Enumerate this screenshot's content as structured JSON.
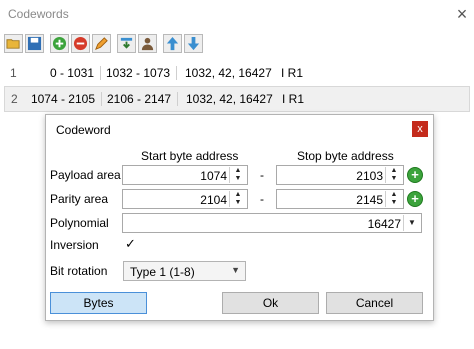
{
  "window": {
    "title": "Codewords",
    "close": "×"
  },
  "toolbar": {
    "icons": [
      "open-folder-icon",
      "save-icon",
      "add-icon",
      "remove-icon",
      "edit-icon",
      "import-icon",
      "user-icon",
      "move-up-icon",
      "move-down-icon"
    ]
  },
  "list": {
    "rows": [
      {
        "index": "1",
        "payload": "0 - 1031",
        "parity": "1032 - 1073",
        "poly": "1032, 42, 16427",
        "flags": "I R1"
      },
      {
        "index": "2",
        "payload": "1074 - 2105",
        "parity": "2106 - 2147",
        "poly": "1032, 42, 16427",
        "flags": "I R1"
      }
    ]
  },
  "dialog": {
    "title": "Codeword",
    "close": "x",
    "start_header": "Start byte address",
    "stop_header": "Stop byte address",
    "payload_label": "Payload area",
    "payload_start": "1074",
    "payload_stop": "2103",
    "parity_label": "Parity area",
    "parity_start": "2104",
    "parity_stop": "2145",
    "dash": "-",
    "polynomial_label": "Polynomial",
    "polynomial_value": "16427",
    "inversion_label": "Inversion",
    "inversion_checked": "✓",
    "bit_rotation_label": "Bit rotation",
    "bit_rotation_value": "Type 1 (1-8)",
    "bytes_button": "Bytes",
    "ok_button": "Ok",
    "cancel_button": "Cancel"
  },
  "colors": {
    "accent_blue": "#cce4f7",
    "close_red": "#c42b1c",
    "add_green": "#3ca33c"
  }
}
